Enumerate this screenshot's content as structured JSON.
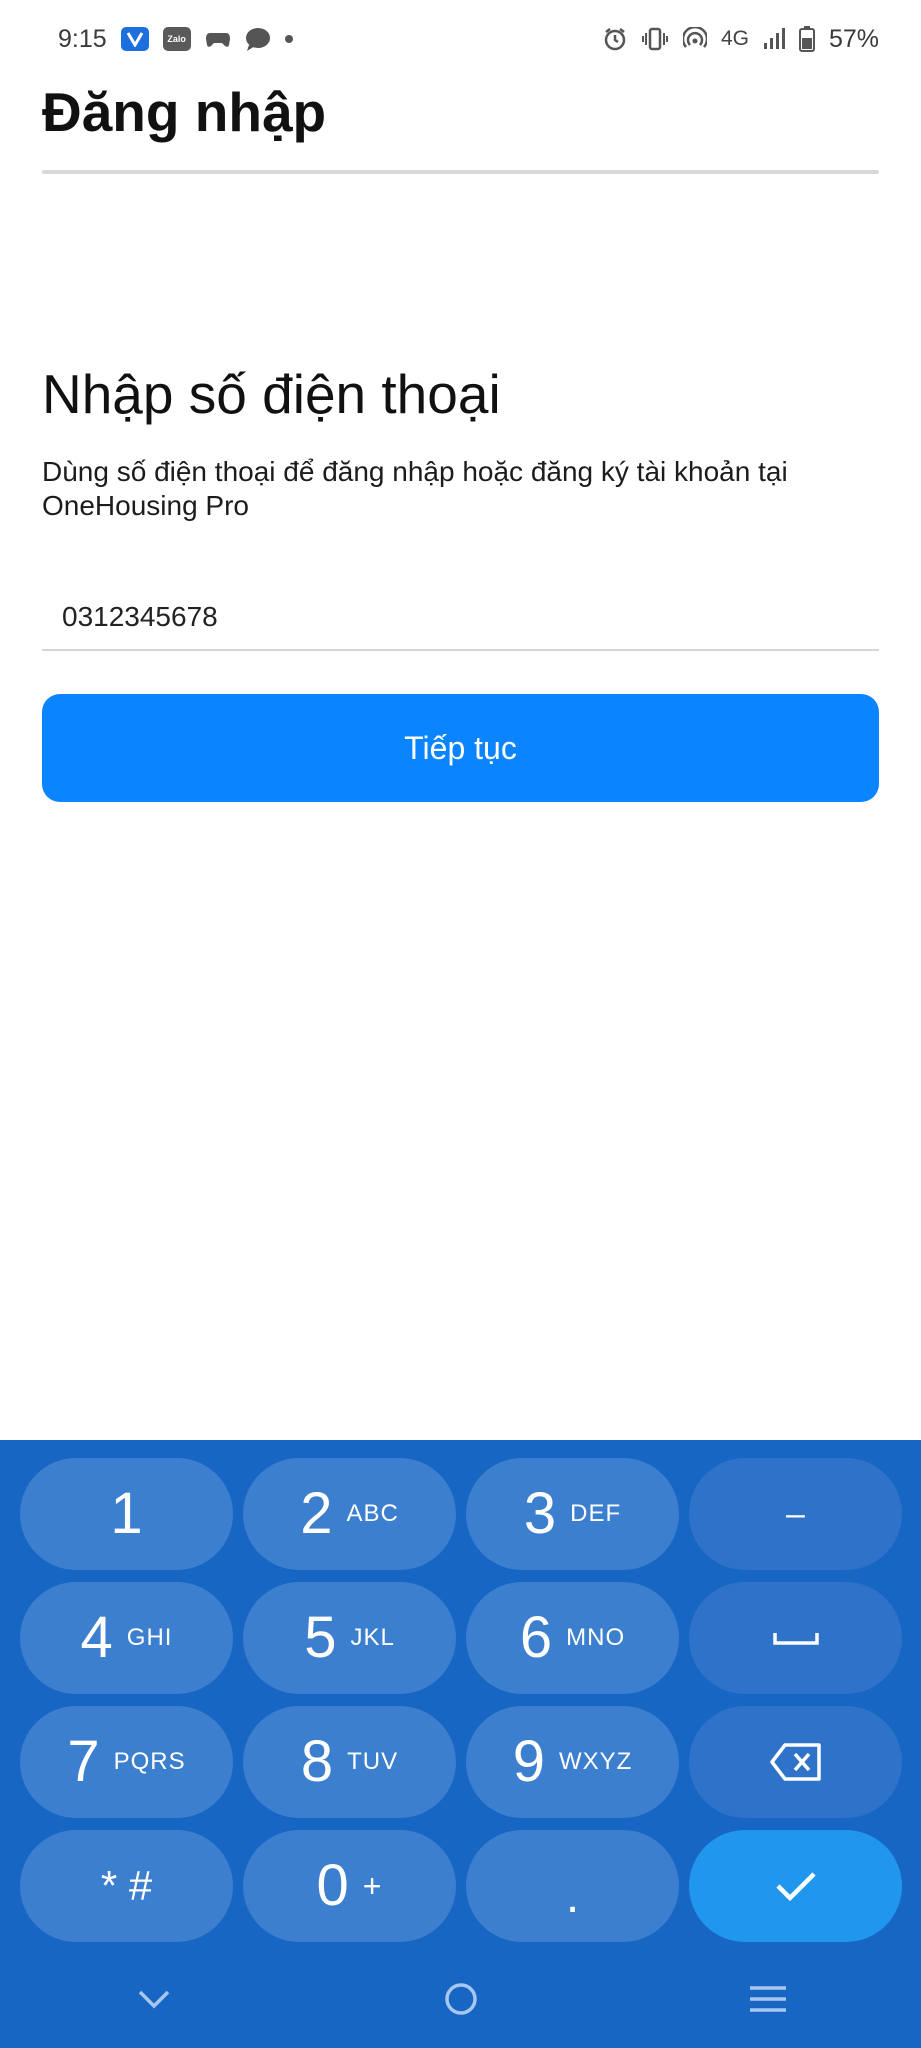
{
  "status_bar": {
    "time": "9:15",
    "network": "4G",
    "battery": "57%",
    "left_icons": [
      "vietcombank-icon",
      "zalo-icon",
      "game-controller-icon",
      "messages-icon",
      "dot-icon"
    ],
    "right_icons": [
      "alarm-icon",
      "vibrate-icon",
      "hotspot-icon",
      "signal-icon",
      "battery-icon"
    ],
    "zalo_label": "Zalo"
  },
  "header": {
    "title": "Đăng nhập"
  },
  "main": {
    "section_title": "Nhập số điện thoại",
    "description": "Dùng số điện thoại để đăng nhập hoặc đăng ký tài khoản tại OneHousing Pro",
    "phone_input": {
      "value": "0312345678",
      "placeholder": ""
    },
    "continue_label": "Tiếp tục"
  },
  "keyboard": {
    "keys": [
      {
        "num": "1",
        "letters": ""
      },
      {
        "num": "2",
        "letters": "ABC"
      },
      {
        "num": "3",
        "letters": "DEF"
      },
      {
        "num": "–",
        "letters": ""
      },
      {
        "num": "4",
        "letters": "GHI"
      },
      {
        "num": "5",
        "letters": "JKL"
      },
      {
        "num": "6",
        "letters": "MNO"
      },
      {
        "num": "",
        "letters": ""
      },
      {
        "num": "7",
        "letters": "PQRS"
      },
      {
        "num": "8",
        "letters": "TUV"
      },
      {
        "num": "9",
        "letters": "WXYZ"
      },
      {
        "num": "",
        "letters": ""
      },
      {
        "num": "* #",
        "letters": ""
      },
      {
        "num": "0",
        "letters": "+"
      },
      {
        "num": ".",
        "letters": ""
      },
      {
        "num": "",
        "letters": ""
      }
    ],
    "colors": {
      "background": "#1766c4",
      "key": "#3d7fcf",
      "done_key": "#2196ee"
    }
  },
  "nav_bar": {
    "icons": [
      "chevron-down-icon",
      "home-circle-icon",
      "menu-icon"
    ]
  },
  "colors": {
    "accent": "#0a84ff"
  }
}
